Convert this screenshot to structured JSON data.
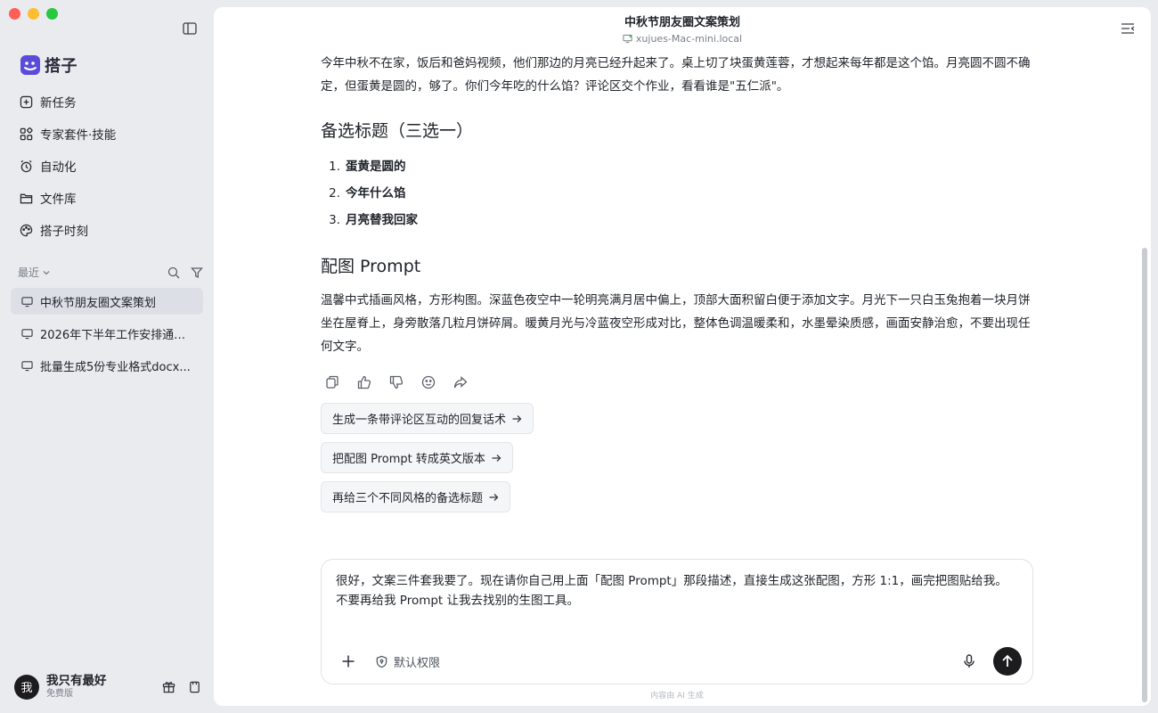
{
  "app": {
    "brand": "搭子"
  },
  "sidebar": {
    "nav": [
      {
        "label": "新任务",
        "icon": "new-task-icon"
      },
      {
        "label": "专家套件·技能",
        "icon": "apps-icon"
      },
      {
        "label": "自动化",
        "icon": "alarm-clock-icon"
      },
      {
        "label": "文件库",
        "icon": "folder-icon"
      },
      {
        "label": "搭子时刻",
        "icon": "palette-icon"
      }
    ],
    "recent_label": "最近",
    "recent": [
      {
        "label": "中秋节朋友圈文案策划",
        "active": true
      },
      {
        "label": "2026年下半年工作安排通知..."
      },
      {
        "label": "批量生成5份专业格式docx..."
      }
    ],
    "user": {
      "avatar": "我",
      "name": "我只有最好",
      "plan": "免费版"
    }
  },
  "header": {
    "title": "中秋节朋友圈文案策划",
    "device": "xujues-Mac-mini.local"
  },
  "content": {
    "intro": "今年中秋不在家，饭后和爸妈视频，他们那边的月亮已经升起来了。桌上切了块蛋黄莲蓉，才想起来每年都是这个馅。月亮圆不圆不确定，但蛋黄是圆的，够了。你们今年吃的什么馅？评论区交个作业，看看谁是\"五仁派\"。",
    "titles_heading": "备选标题（三选一）",
    "titles": [
      {
        "num": "1.",
        "text": "蛋黄是圆的"
      },
      {
        "num": "2.",
        "text": "今年什么馅"
      },
      {
        "num": "3.",
        "text": "月亮替我回家"
      }
    ],
    "prompt_heading": "配图 Prompt",
    "prompt_text": "温馨中式插画风格，方形构图。深蓝色夜空中一轮明亮满月居中偏上，顶部大面积留白便于添加文字。月光下一只白玉兔抱着一块月饼坐在屋脊上，身旁散落几粒月饼碎屑。暖黄月光与冷蓝夜空形成对比，整体色调温暖柔和，水墨晕染质感，画面安静治愈，不要出现任何文字。",
    "suggestions": [
      "生成一条带评论区互动的回复话术",
      "把配图 Prompt 转成英文版本",
      "再给三个不同风格的备选标题"
    ]
  },
  "composer": {
    "text": "很好，文案三件套我要了。现在请你自己用上面「配图 Prompt」那段描述，直接生成这张配图，方形 1:1，画完把图贴给我。\n不要再给我 Prompt 让我去找别的生图工具。",
    "permission": "默认权限"
  },
  "footnote": "内容由 AI 生成"
}
